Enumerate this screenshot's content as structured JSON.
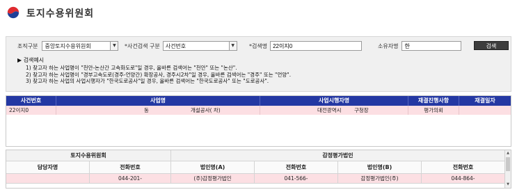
{
  "app": {
    "title": "토지수용위원회"
  },
  "search": {
    "org_label": "조직구분",
    "org_value": "중앙토지수용위원회",
    "case_type_label": "*사건검색 구분",
    "case_type_value": "사건번호",
    "keyword_label": "*검색명",
    "keyword_value": "22이지0",
    "owner_label": "소유자명",
    "owner_value": "한",
    "search_button": "검색"
  },
  "examples": {
    "title": "▶ 검색예시",
    "lines": [
      "1) 찾고자 하는 사업명이 \"천안-논산간 고속화도로\"일 경우, 올바른 검색어는 \"천안\" 또는 \"논산\".",
      "2) 찾고자 하는 사업명이 \"경부고속도로(경주-언양간) 확장공사, 경주시2차\"일 경우, 올바른 검색어는 \"경주\" 또는 \"언양\".",
      "3) 찾고자 하는 사업의 사업시행자가 \"한국도로공사\"일 경우, 올바른 검색어는 \"한국도로공사\" 또는 \"도로공사\"."
    ]
  },
  "results": {
    "headers": [
      "사건번호",
      "사업명",
      "사업시행자명",
      "재결진행사항",
      "재결일자"
    ],
    "rows": [
      {
        "case_no": "22이지0",
        "project_a": "동",
        "project_b": "개설공사( 차)",
        "executor_a": "대전광역시",
        "executor_b": "구청장",
        "status": "평가의뢰",
        "date": ""
      }
    ]
  },
  "bottom": {
    "group1": "토지수용위원회",
    "group2": "감정평가법인",
    "headers": [
      "담당자명",
      "전화번호",
      "법인명(A)",
      "전화번호",
      "법인명(B)",
      "전화번호"
    ],
    "row": [
      "",
      "044-201-",
      "(주)감정평가법인",
      "041-566-",
      "감정평가법인(주)",
      "044-864-"
    ]
  }
}
